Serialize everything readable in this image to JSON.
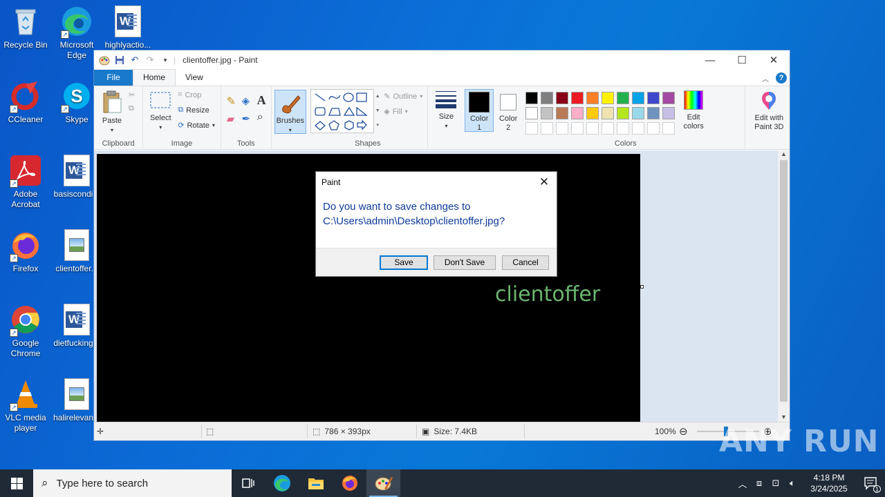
{
  "desktop": {
    "icons": [
      {
        "label": "Recycle Bin"
      },
      {
        "label": "Microsoft Edge"
      },
      {
        "label": "highlyactio..."
      },
      {
        "label": "CCleaner"
      },
      {
        "label": "Skype"
      },
      {
        "label": "Adobe Acrobat"
      },
      {
        "label": "basiscondi..."
      },
      {
        "label": "Firefox"
      },
      {
        "label": "clientoffer..."
      },
      {
        "label": "Google Chrome"
      },
      {
        "label": "dietfucking..."
      },
      {
        "label": "VLC media player"
      },
      {
        "label": "halirelevan..."
      }
    ]
  },
  "window": {
    "title": "clientoffer.jpg - Paint",
    "menu": {
      "file": "File",
      "home": "Home",
      "view": "View"
    },
    "ribbon": {
      "clipboard": {
        "label": "Clipboard",
        "paste": "Paste"
      },
      "image": {
        "label": "Image",
        "select": "Select",
        "crop": "Crop",
        "resize": "Resize",
        "rotate": "Rotate"
      },
      "tools": {
        "label": "Tools"
      },
      "brushes": "Brushes",
      "shapes": {
        "label": "Shapes",
        "outline": "Outline",
        "fill": "Fill"
      },
      "size": "Size",
      "colors": {
        "label": "Colors",
        "color1": "Color 1",
        "color2": "Color 2",
        "edit_colors": "Edit colors",
        "edit_paint3d": "Edit with Paint 3D",
        "palette_row1": [
          "#000000",
          "#7f7f7f",
          "#880015",
          "#ed1c24",
          "#ff7f27",
          "#fff200",
          "#22b14c",
          "#00a2e8",
          "#3f48cc",
          "#a349a4"
        ],
        "palette_row2": [
          "#ffffff",
          "#c3c3c3",
          "#b97a57",
          "#ffaec9",
          "#ffc90e",
          "#efe4b0",
          "#b5e61d",
          "#99d9ea",
          "#7092be",
          "#c8bfe7"
        ]
      }
    },
    "canvas_text": "clientoffer",
    "status": {
      "dimensions": "786 × 393px",
      "size": "Size: 7.4KB",
      "zoom": "100%"
    }
  },
  "dialog": {
    "title": "Paint",
    "message_line1": "Do you want to save changes to",
    "message_line2": "C:\\Users\\admin\\Desktop\\clientoffer.jpg?",
    "save": "Save",
    "dont_save": "Don't Save",
    "cancel": "Cancel"
  },
  "taskbar": {
    "search_placeholder": "Type here to search",
    "time": "4:18 PM",
    "date": "3/24/2025",
    "notification_count": "1"
  },
  "watermark": "ANY RUN"
}
